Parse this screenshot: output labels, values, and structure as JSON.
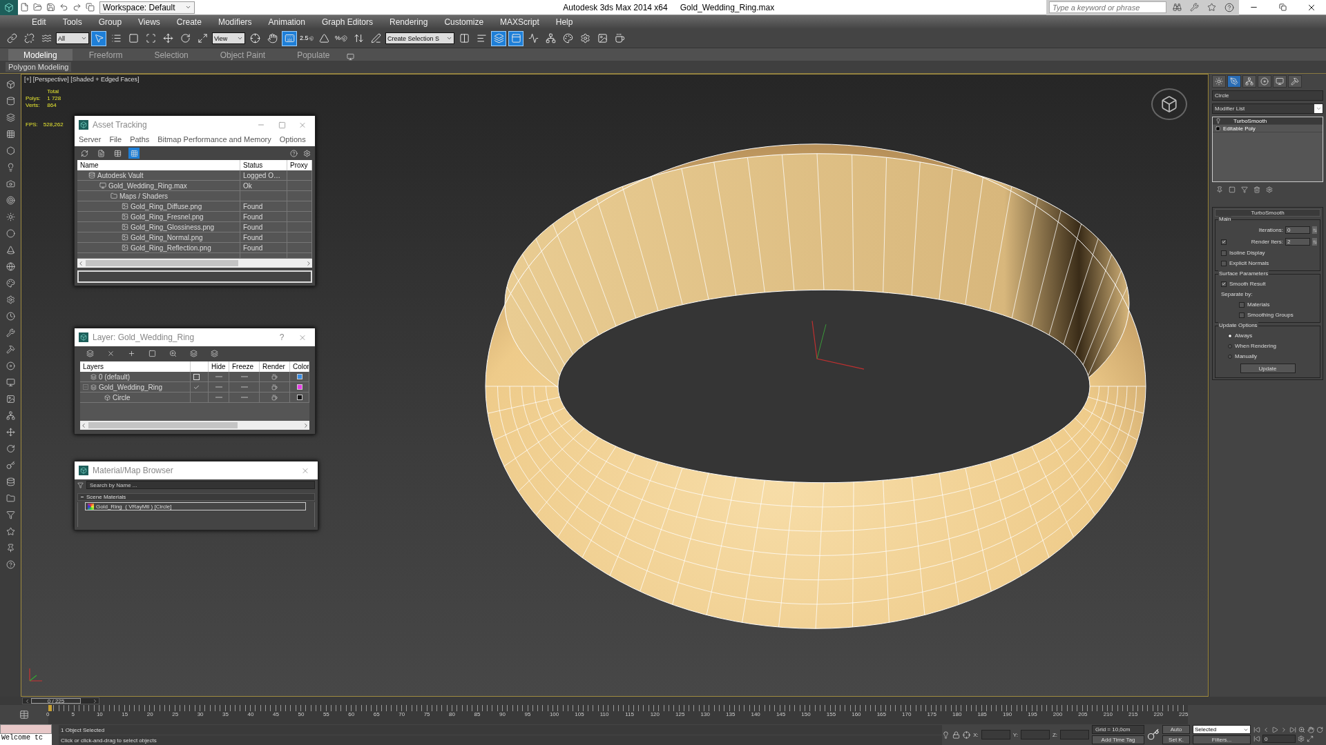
{
  "window": {
    "title": "Autodesk 3ds Max  2014 x64",
    "file": "Gold_Wedding_Ring.max",
    "workspace": "Workspace: Default",
    "search": {
      "placeholder": "Type a keyword or phrase"
    }
  },
  "menu": [
    "Edit",
    "Tools",
    "Group",
    "Views",
    "Create",
    "Modifiers",
    "Animation",
    "Graph Editors",
    "Rendering",
    "Customize",
    "MAXScript",
    "Help"
  ],
  "toolbar": [
    {
      "kind": "icon",
      "selected": false
    },
    {
      "kind": "icon",
      "selected": false
    },
    {
      "kind": "icon",
      "selected": false
    },
    {
      "kind": "dropdown",
      "value": "All"
    },
    {
      "kind": "icon",
      "selected": true
    },
    {
      "kind": "icon",
      "selected": false
    },
    {
      "kind": "icon",
      "selected": false
    },
    {
      "kind": "icon",
      "selected": false
    },
    {
      "kind": "icon",
      "selected": false
    },
    {
      "kind": "icon",
      "selected": false
    },
    {
      "kind": "icon",
      "selected": false
    },
    {
      "kind": "dropdown",
      "value": "View"
    },
    {
      "kind": "icon",
      "selected": false
    },
    {
      "kind": "icon",
      "selected": false
    },
    {
      "kind": "icon",
      "selected": true
    },
    {
      "kind": "snap",
      "label": "2.5",
      "selected": false
    },
    {
      "kind": "icon",
      "selected": false
    },
    {
      "kind": "snap",
      "label": "%",
      "selected": false
    },
    {
      "kind": "icon",
      "selected": false
    },
    {
      "kind": "icon",
      "selected": false
    },
    {
      "kind": "dropdown",
      "value": "Create Selection S"
    },
    {
      "kind": "icon",
      "selected": false
    },
    {
      "kind": "icon",
      "selected": false
    },
    {
      "kind": "icon",
      "selected": true
    },
    {
      "kind": "icon",
      "selected": true
    },
    {
      "kind": "icon",
      "selected": false
    },
    {
      "kind": "icon",
      "selected": false
    },
    {
      "kind": "icon",
      "selected": false
    },
    {
      "kind": "icon",
      "selected": false
    },
    {
      "kind": "icon",
      "selected": false
    },
    {
      "kind": "icon",
      "selected": false
    }
  ],
  "ribbon": {
    "tabs": [
      {
        "label": "Modeling",
        "selected": true
      },
      {
        "label": "Freeform",
        "selected": false
      },
      {
        "label": "Selection",
        "selected": false
      },
      {
        "label": "Object Paint",
        "selected": false
      },
      {
        "label": "Populate",
        "selected": false
      }
    ],
    "panel": "Polygon Modeling"
  },
  "viewport": {
    "label": "[+] [Perspective] [Shaded + Edged Faces]",
    "stats": {
      "header": "Total",
      "rows": [
        {
          "label": "Polys:",
          "value": "1 728"
        },
        {
          "label": "Verts:",
          "value": "864"
        }
      ],
      "fps": {
        "label": "FPS:",
        "value": "528,262"
      }
    }
  },
  "asset_tracking": {
    "title": "Asset Tracking",
    "menu": [
      "Server",
      "File",
      "Paths",
      "Bitmap Performance and Memory",
      "Options"
    ],
    "tools": [
      {
        "selected": false
      },
      {
        "selected": false
      },
      {
        "selected": false
      },
      {
        "selected": true
      }
    ],
    "columns": [
      "Name",
      "Status",
      "Proxy"
    ],
    "rows": [
      {
        "kind": "vault",
        "name": "Autodesk Vault",
        "status": "Logged O…",
        "children": [
          {
            "kind": "scene",
            "name": "Gold_Wedding_Ring.max",
            "status": "Ok",
            "children": [
              {
                "kind": "folder",
                "name": "Maps / Shaders",
                "children": [
                  {
                    "kind": "image",
                    "name": "Gold_Ring_Diffuse.png",
                    "status": "Found"
                  },
                  {
                    "kind": "image",
                    "name": "Gold_Ring_Fresnel.png",
                    "status": "Found"
                  },
                  {
                    "kind": "image",
                    "name": "Gold_Ring_Glossiness.png",
                    "status": "Found"
                  },
                  {
                    "kind": "image",
                    "name": "Gold_Ring_Normal.png",
                    "status": "Found"
                  },
                  {
                    "kind": "image",
                    "name": "Gold_Ring_Reflection.png",
                    "status": "Found"
                  }
                ]
              }
            ]
          }
        ]
      }
    ]
  },
  "layer_manager": {
    "title": "Layer: Gold_Wedding_Ring",
    "help": "?",
    "columns": [
      "Layers",
      "Hide",
      "Freeze",
      "Render",
      "Color"
    ],
    "rows": [
      {
        "kind": "layer",
        "name": "0 (default)",
        "current": false,
        "color": "#3a8ee6"
      },
      {
        "kind": "layer",
        "name": "Gold_Wedding_Ring",
        "current": true,
        "expanded": true,
        "color": "#e83ee8",
        "children": [
          {
            "kind": "object",
            "name": "Circle",
            "color": "#141414"
          }
        ]
      }
    ]
  },
  "material_browser": {
    "title": "Material/Map Browser",
    "search": {
      "placeholder": "Search by Name ..."
    },
    "groups": [
      {
        "label": "Scene Materials",
        "expanded": true,
        "items": [
          "Gold_Ring  ( VRayMtl ) [Circle]"
        ]
      }
    ]
  },
  "command_panel": {
    "tabs": [
      {
        "selected": false
      },
      {
        "selected": true
      },
      {
        "selected": false
      },
      {
        "selected": false
      },
      {
        "selected": false
      },
      {
        "selected": false
      }
    ],
    "object_name": "Circle",
    "modifier_list": "Modifier List",
    "stack": [
      {
        "kind": "modifier",
        "label": "TurboSmooth",
        "selected": true
      },
      {
        "kind": "base",
        "label": "Editable Poly",
        "selected": false
      }
    ],
    "rollout": {
      "title": "TurboSmooth",
      "main": {
        "title": "Main",
        "iterations": {
          "label": "Iterations:",
          "value": "0"
        },
        "render_iters": {
          "label": "Render Iters:",
          "value": "2",
          "checked": true
        },
        "checks": [
          {
            "label": "Isoline Display",
            "checked": false
          },
          {
            "label": "Explicit Normals",
            "checked": false
          }
        ]
      },
      "surface": {
        "title": "Surface Parameters",
        "smooth_result": {
          "label": "Smooth Result",
          "checked": true
        },
        "separate_label": "Separate by:",
        "separate": [
          {
            "label": "Materials",
            "checked": false
          },
          {
            "label": "Smoothing Groups",
            "checked": false
          }
        ]
      },
      "update": {
        "title": "Update Options",
        "options": [
          {
            "label": "Always",
            "selected": true
          },
          {
            "label": "When Rendering",
            "selected": false
          },
          {
            "label": "Manually",
            "selected": false
          }
        ],
        "button": "Update"
      }
    }
  },
  "timeline": {
    "slider": "0 / 225",
    "level": 0,
    "ticks": [
      "0",
      "5",
      "10",
      "15",
      "20",
      "25",
      "30",
      "35",
      "40",
      "45",
      "50",
      "55",
      "60",
      "65",
      "70",
      "75",
      "80",
      "85",
      "90",
      "95",
      "100",
      "105",
      "110",
      "115",
      "120",
      "125",
      "130",
      "135",
      "140",
      "145",
      "150",
      "155",
      "160",
      "165",
      "170",
      "175",
      "180",
      "185",
      "190",
      "195",
      "200",
      "205",
      "210",
      "215",
      "220",
      "225"
    ]
  },
  "status_bar": {
    "listener": "Welcome tc",
    "selection": "1 Object Selected",
    "prompt": "Click or click-and-drag to select objects",
    "coords": [
      "X:",
      "Y:",
      "Z:"
    ],
    "grid": "Grid = 10,0cm",
    "time_tag": "Add Time Tag",
    "auto_key": "Auto",
    "set_key": "Set K.",
    "key_filter": "Selected",
    "filters": "Filters...",
    "frame": "0"
  }
}
